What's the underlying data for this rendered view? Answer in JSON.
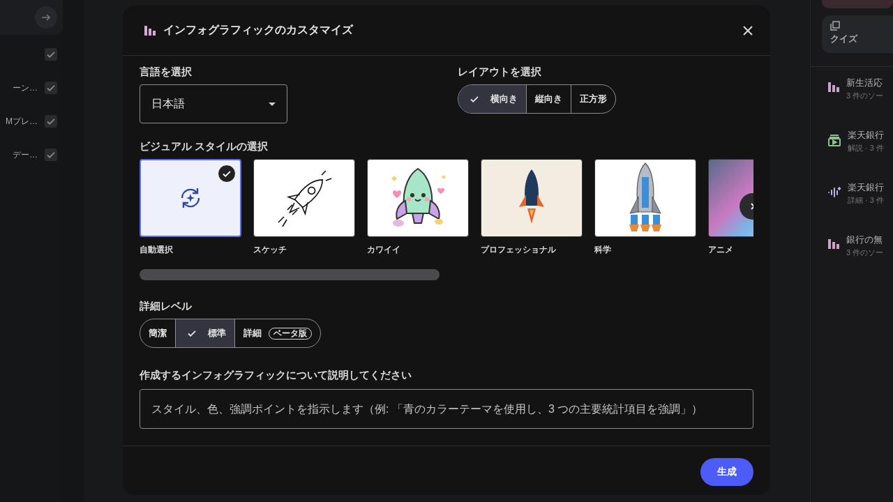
{
  "left_panel": {
    "items": [
      {
        "checked": true
      },
      {
        "label": "ーン…",
        "checked": true
      },
      {
        "label": "Mプレ…",
        "checked": true
      },
      {
        "label": "デー…",
        "checked": true
      }
    ]
  },
  "right_panel": {
    "quiz_card": {
      "label": "クイズ"
    },
    "artifacts": [
      {
        "kind": "infographic",
        "title": "新生活応",
        "subtitle": "3 件のソー"
      },
      {
        "kind": "video",
        "title": "楽天銀行",
        "subtitle": "解説 · 3 件"
      },
      {
        "kind": "audio",
        "title": "楽天銀行",
        "subtitle": "詳細 · 3 件"
      },
      {
        "kind": "infographic",
        "title": "銀行の無",
        "subtitle": "3 件のソー"
      }
    ]
  },
  "dialog": {
    "title": "インフォグラフィックのカスタマイズ",
    "language": {
      "label": "言語を選択",
      "value": "日本語"
    },
    "layout": {
      "label": "レイアウトを選択",
      "options": [
        {
          "label": "横向き",
          "selected": true
        },
        {
          "label": "縦向き",
          "selected": false
        },
        {
          "label": "正方形",
          "selected": false
        }
      ]
    },
    "visual_style": {
      "label": "ビジュアル スタイルの選択",
      "styles": [
        {
          "kind": "auto",
          "label": "自動選択",
          "selected": true
        },
        {
          "kind": "sketch",
          "label": "スケッチ",
          "selected": false
        },
        {
          "kind": "kawaii",
          "label": "カワイイ",
          "selected": false
        },
        {
          "kind": "professional",
          "label": "プロフェッショナル",
          "selected": false
        },
        {
          "kind": "science",
          "label": "科学",
          "selected": false
        },
        {
          "kind": "anime",
          "label": "アニメ",
          "selected": false
        }
      ]
    },
    "detail_level": {
      "label": "詳細レベル",
      "options": [
        {
          "label": "簡潔",
          "selected": false
        },
        {
          "label": "標準",
          "selected": true
        },
        {
          "label": "詳細",
          "badge": "ベータ版",
          "selected": false
        }
      ]
    },
    "description": {
      "label": "作成するインフォグラフィックについて説明してください",
      "placeholder": "スタイル、色、強調ポイントを指示します（例: 「青のカラーテーマを使用し、3 つの主要統計項目を強調」）"
    },
    "generate_button": "生成"
  }
}
